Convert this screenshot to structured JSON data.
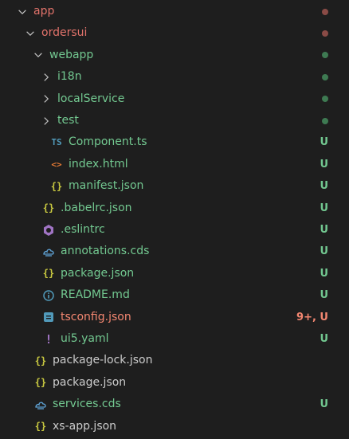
{
  "explorer": {
    "rows": [
      {
        "label": "app",
        "kind": "folder",
        "open": true,
        "depth": 0,
        "color": "#e2736b",
        "marker": "dot",
        "marker_color": "#8a4b46"
      },
      {
        "label": "ordersui",
        "kind": "folder",
        "open": true,
        "depth": 1,
        "color": "#e2736b",
        "marker": "dot",
        "marker_color": "#8a4b46"
      },
      {
        "label": "webapp",
        "kind": "folder",
        "open": true,
        "depth": 2,
        "color": "#73c991",
        "marker": "dot",
        "marker_color": "#3e7a52"
      },
      {
        "label": "i18n",
        "kind": "folder",
        "open": false,
        "depth": 3,
        "color": "#73c991",
        "marker": "dot",
        "marker_color": "#3e7a52"
      },
      {
        "label": "localService",
        "kind": "folder",
        "open": false,
        "depth": 3,
        "color": "#73c991",
        "marker": "dot",
        "marker_color": "#3e7a52"
      },
      {
        "label": "test",
        "kind": "folder",
        "open": false,
        "depth": 3,
        "color": "#73c991",
        "marker": "dot",
        "marker_color": "#3e7a52"
      },
      {
        "label": "Component.ts",
        "kind": "file",
        "icon": "typescript-icon",
        "icon_text": "TS",
        "icon_color": "#519aba",
        "depth": 3,
        "color": "#73c991",
        "marker": "text",
        "status": "U"
      },
      {
        "label": "index.html",
        "kind": "file",
        "icon": "html-icon",
        "icon_text": "<>",
        "icon_color": "#e37933",
        "depth": 3,
        "color": "#73c991",
        "marker": "text",
        "status": "U"
      },
      {
        "label": "manifest.json",
        "kind": "file",
        "icon": "json-icon",
        "icon_text": "{}",
        "icon_color": "#cbcb41",
        "depth": 3,
        "color": "#73c991",
        "marker": "text",
        "status": "U"
      },
      {
        "label": ".babelrc.json",
        "kind": "file",
        "icon": "json-icon",
        "icon_text": "{}",
        "icon_color": "#cbcb41",
        "depth": 2,
        "color": "#73c991",
        "marker": "text",
        "status": "U"
      },
      {
        "label": ".eslintrc",
        "kind": "file",
        "icon": "eslint-icon",
        "icon_text": "",
        "icon_color": "#a074c4",
        "depth": 2,
        "color": "#73c991",
        "marker": "text",
        "status": "U"
      },
      {
        "label": "annotations.cds",
        "kind": "file",
        "icon": "cds-icon",
        "icon_text": "",
        "icon_color": "#5fa3d6",
        "depth": 2,
        "color": "#73c991",
        "marker": "text",
        "status": "U"
      },
      {
        "label": "package.json",
        "kind": "file",
        "icon": "json-icon",
        "icon_text": "{}",
        "icon_color": "#cbcb41",
        "depth": 2,
        "color": "#73c991",
        "marker": "text",
        "status": "U"
      },
      {
        "label": "README.md",
        "kind": "file",
        "icon": "info-icon",
        "icon_text": "",
        "icon_color": "#519aba",
        "depth": 2,
        "color": "#73c991",
        "marker": "text",
        "status": "U"
      },
      {
        "label": "tsconfig.json",
        "kind": "file",
        "icon": "tsconfig-icon",
        "icon_text": "",
        "icon_color": "#519aba",
        "depth": 2,
        "color": "#f48771",
        "marker": "text",
        "status": "9+, U",
        "status_color": "#f48771"
      },
      {
        "label": "ui5.yaml",
        "kind": "file",
        "icon": "yaml-icon",
        "icon_text": "!",
        "icon_color": "#a074c4",
        "depth": 2,
        "color": "#73c991",
        "marker": "text",
        "status": "U"
      },
      {
        "label": "package-lock.json",
        "kind": "file",
        "icon": "json-icon",
        "icon_text": "{}",
        "icon_color": "#cbcb41",
        "depth": 1,
        "color": "#cccccc",
        "marker": "none"
      },
      {
        "label": "package.json",
        "kind": "file",
        "icon": "json-icon",
        "icon_text": "{}",
        "icon_color": "#cbcb41",
        "depth": 1,
        "color": "#cccccc",
        "marker": "none"
      },
      {
        "label": "services.cds",
        "kind": "file",
        "icon": "cds-icon",
        "icon_text": "",
        "icon_color": "#5fa3d6",
        "depth": 1,
        "color": "#73c991",
        "marker": "text",
        "status": "U"
      },
      {
        "label": "xs-app.json",
        "kind": "file",
        "icon": "json-icon",
        "icon_text": "{}",
        "icon_color": "#cbcb41",
        "depth": 1,
        "color": "#cccccc",
        "marker": "none"
      }
    ]
  }
}
